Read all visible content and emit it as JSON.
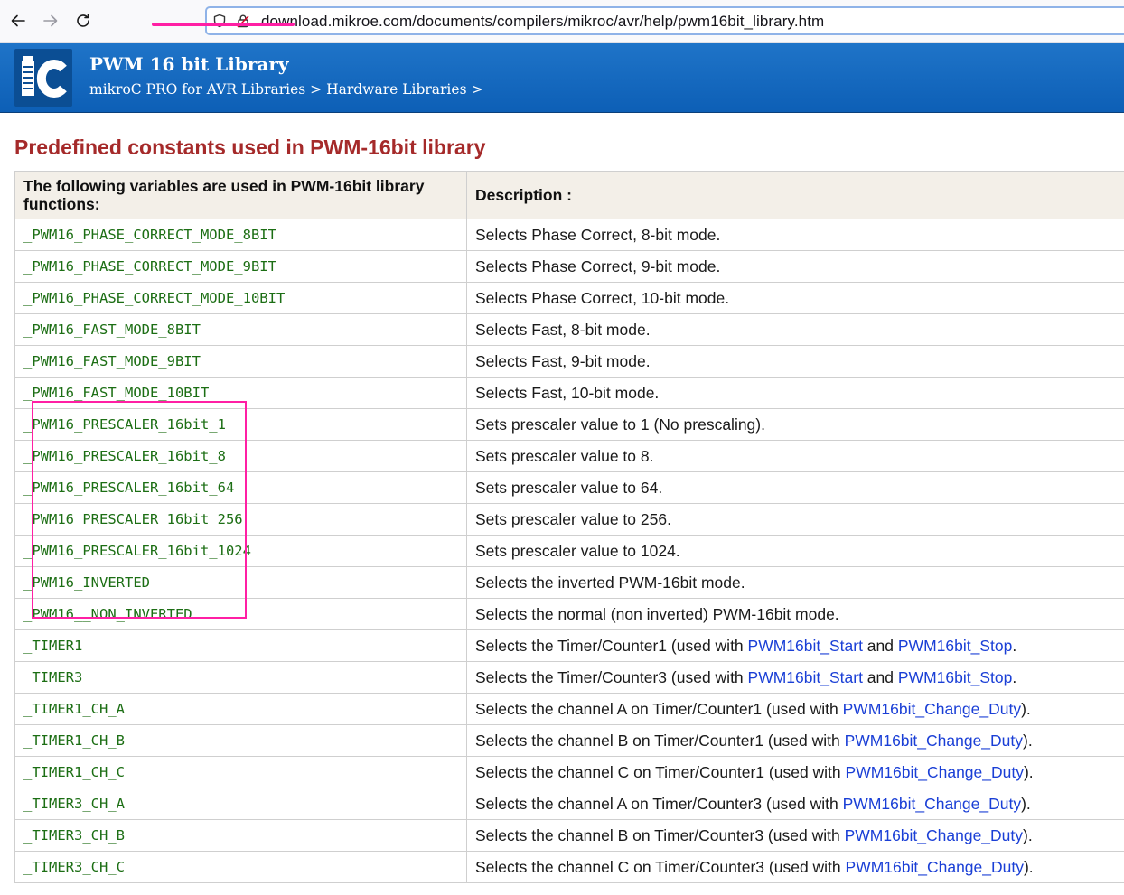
{
  "browser": {
    "url": "download.mikroe.com/documents/compilers/mikroc/avr/help/pwm16bit_library.htm"
  },
  "header": {
    "title": "PWM 16 bit Library",
    "breadcrumb": {
      "item1": "mikroC PRO for AVR Libraries",
      "sep1": " > ",
      "item2": "Hardware Libraries",
      "sep2": " >"
    }
  },
  "section": {
    "title": "Predefined constants used in PWM-16bit library"
  },
  "table": {
    "headers": {
      "col1": "The following variables are used in PWM-16bit library functions:",
      "col2": "Description :"
    },
    "rows": [
      {
        "const": "_PWM16_PHASE_CORRECT_MODE_8BIT",
        "desc": "Selects Phase Correct, 8-bit mode."
      },
      {
        "const": "_PWM16_PHASE_CORRECT_MODE_9BIT",
        "desc": "Selects Phase Correct, 9-bit mode."
      },
      {
        "const": "_PWM16_PHASE_CORRECT_MODE_10BIT",
        "desc": "Selects Phase Correct, 10-bit mode."
      },
      {
        "const": "_PWM16_FAST_MODE_8BIT",
        "desc": "Selects Fast, 8-bit mode."
      },
      {
        "const": "_PWM16_FAST_MODE_9BIT",
        "desc": "Selects Fast, 9-bit mode."
      },
      {
        "const": "_PWM16_FAST_MODE_10BIT",
        "desc": "Selects Fast, 10-bit mode."
      },
      {
        "const": "_PWM16_PRESCALER_16bit_1",
        "desc": "Sets prescaler value to 1 (No prescaling)."
      },
      {
        "const": "_PWM16_PRESCALER_16bit_8",
        "desc": "Sets prescaler value to 8."
      },
      {
        "const": "_PWM16_PRESCALER_16bit_64",
        "desc": "Sets prescaler value to 64."
      },
      {
        "const": "_PWM16_PRESCALER_16bit_256",
        "desc": "Sets prescaler value to 256."
      },
      {
        "const": "_PWM16_PRESCALER_16bit_1024",
        "desc": "Sets prescaler value to 1024."
      },
      {
        "const": "_PWM16_INVERTED",
        "desc": "Selects the inverted PWM-16bit mode."
      },
      {
        "const": "_PWM16__NON_INVERTED",
        "desc": "Selects the normal (non inverted) PWM-16bit mode."
      }
    ],
    "timer1": {
      "const": "_TIMER1",
      "pre": "Selects the Timer/Counter1 (used with ",
      "link1": "PWM16bit_Start",
      "mid": " and ",
      "link2": "PWM16bit_Stop",
      "post": "."
    },
    "timer3": {
      "const": "_TIMER3",
      "pre": "Selects the Timer/Counter3 (used with ",
      "link1": "PWM16bit_Start",
      "mid": " and ",
      "link2": "PWM16bit_Stop",
      "post": "."
    },
    "channels": [
      {
        "const": "_TIMER1_CH_A",
        "pre": "Selects the channel A on Timer/Counter1 (used with ",
        "link": "PWM16bit_Change_Duty",
        "post": ")."
      },
      {
        "const": "_TIMER1_CH_B",
        "pre": "Selects the channel B on Timer/Counter1 (used with ",
        "link": "PWM16bit_Change_Duty",
        "post": ")."
      },
      {
        "const": "_TIMER1_CH_C",
        "pre": "Selects the channel C on Timer/Counter1 (used with ",
        "link": "PWM16bit_Change_Duty",
        "post": ")."
      },
      {
        "const": "_TIMER3_CH_A",
        "pre": "Selects the channel A on Timer/Counter3 (used with ",
        "link": "PWM16bit_Change_Duty",
        "post": ")."
      },
      {
        "const": "_TIMER3_CH_B",
        "pre": "Selects the channel B on Timer/Counter3 (used with ",
        "link": "PWM16bit_Change_Duty",
        "post": ")."
      },
      {
        "const": "_TIMER3_CH_C",
        "pre": "Selects the channel C on Timer/Counter3 (used with ",
        "link": "PWM16bit_Change_Duty",
        "post": ")."
      }
    ]
  },
  "colors": {
    "banner": "#0d5fb6",
    "section_title": "#a52a2a",
    "constant_text": "#1c6e14",
    "link": "#1a3fd6",
    "highlight": "#ff1fa4"
  }
}
